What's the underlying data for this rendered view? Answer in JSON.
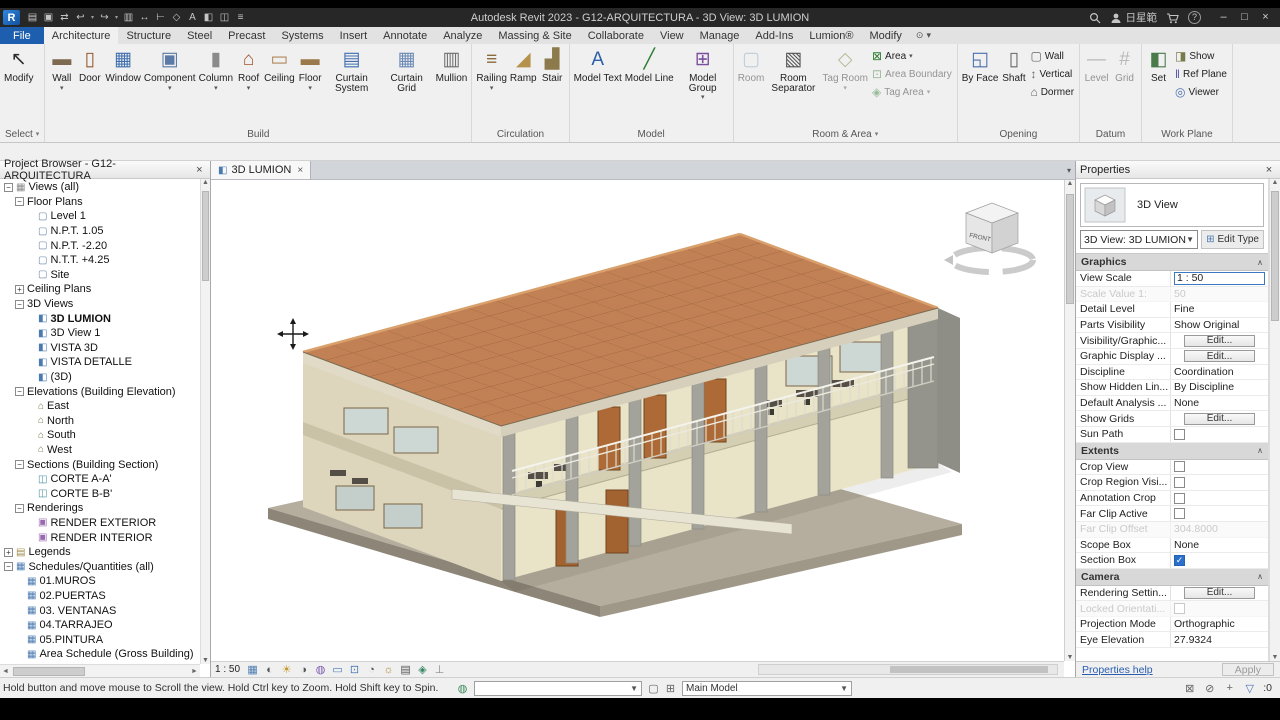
{
  "colors": {
    "accent_blue": "#1d5fae",
    "roof_terracotta": "#c28155",
    "selection_border": "#3a78c0",
    "checkbox_blue": "#2a6fc9"
  },
  "title_bar": {
    "title": "Autodesk Revit 2023 - G12-ARQUITECTURA - 3D View: 3D LUMION",
    "account": "日星範",
    "help_glyph": "?",
    "window_buttons": [
      "–",
      "□",
      "×"
    ],
    "quick_icons": [
      "open-file",
      "save",
      "sync-central",
      "undo",
      "redo",
      "print",
      "measure",
      "aligned-dimension",
      "tag-by-category",
      "text",
      "default-3d",
      "section",
      "thin-lines"
    ]
  },
  "tabs": {
    "file": "File",
    "active": "Architecture",
    "items": [
      "Architecture",
      "Structure",
      "Steel",
      "Precast",
      "Systems",
      "Insert",
      "Annotate",
      "Analyze",
      "Massing & Site",
      "Collaborate",
      "View",
      "Manage",
      "Add-Ins",
      "Lumion®",
      "Modify"
    ]
  },
  "ribbon": {
    "panels": [
      {
        "label": "Select",
        "arrow": true,
        "buttons": [
          {
            "t": "big",
            "label": "Modify",
            "icon": "modify-cursor"
          }
        ]
      },
      {
        "label": "Build",
        "buttons": [
          {
            "t": "big",
            "label": "Wall",
            "icon": "wall",
            "arrow": true
          },
          {
            "t": "big",
            "label": "Door",
            "icon": "door"
          },
          {
            "t": "big",
            "label": "Window",
            "icon": "window"
          },
          {
            "t": "big",
            "label": "Component",
            "icon": "component",
            "arrow": true
          },
          {
            "t": "big",
            "label": "Column",
            "icon": "column",
            "arrow": true
          },
          {
            "t": "big",
            "label": "Roof",
            "icon": "roof",
            "arrow": true
          },
          {
            "t": "big",
            "label": "Ceiling",
            "icon": "ceiling"
          },
          {
            "t": "big",
            "label": "Floor",
            "icon": "floor",
            "arrow": true
          },
          {
            "t": "big",
            "label": "Curtain System",
            "icon": "curtain-system"
          },
          {
            "t": "big",
            "label": "Curtain Grid",
            "icon": "curtain-grid"
          },
          {
            "t": "big",
            "label": "Mullion",
            "icon": "mullion"
          }
        ]
      },
      {
        "label": "Circulation",
        "buttons": [
          {
            "t": "big",
            "label": "Railing",
            "icon": "railing",
            "arrow": true
          },
          {
            "t": "big",
            "label": "Ramp",
            "icon": "ramp"
          },
          {
            "t": "big",
            "label": "Stair",
            "icon": "stair"
          }
        ]
      },
      {
        "label": "Model",
        "buttons": [
          {
            "t": "big",
            "label": "Model Text",
            "icon": "model-text"
          },
          {
            "t": "big",
            "label": "Model Line",
            "icon": "model-line"
          },
          {
            "t": "big",
            "label": "Model Group",
            "icon": "model-group",
            "arrow": true
          }
        ]
      },
      {
        "label": "Room & Area",
        "arrow": true,
        "buttons": [
          {
            "t": "big",
            "label": "Room",
            "icon": "room",
            "disabled": true
          },
          {
            "t": "big",
            "label": "Room Separator",
            "icon": "room-separator"
          },
          {
            "t": "big",
            "label": "Tag Room",
            "icon": "tag-room",
            "arrow": true,
            "disabled": true
          },
          {
            "t": "stack",
            "items": [
              {
                "label": "Area",
                "icon": "area",
                "arrow": true
              },
              {
                "label": "Area Boundary",
                "icon": "area-boundary",
                "disabled": true
              },
              {
                "label": "Tag Area",
                "icon": "tag-area",
                "arrow": true,
                "disabled": true
              }
            ]
          }
        ]
      },
      {
        "label": "Opening",
        "buttons": [
          {
            "t": "big",
            "label": "By Face",
            "icon": "by-face"
          },
          {
            "t": "big",
            "label": "Shaft",
            "icon": "shaft"
          },
          {
            "t": "stack",
            "items": [
              {
                "label": "Wall",
                "icon": "opening-wall"
              },
              {
                "label": "Vertical",
                "icon": "vertical"
              },
              {
                "label": "Dormer",
                "icon": "dormer"
              }
            ]
          }
        ]
      },
      {
        "label": "Datum",
        "buttons": [
          {
            "t": "big",
            "label": "Level",
            "icon": "level",
            "disabled": true
          },
          {
            "t": "big",
            "label": "Grid",
            "icon": "grid",
            "disabled": true
          }
        ]
      },
      {
        "label": "Work Plane",
        "buttons": [
          {
            "t": "big",
            "label": "Set",
            "icon": "set"
          },
          {
            "t": "stack",
            "items": [
              {
                "label": "Show",
                "icon": "show"
              },
              {
                "label": "Ref Plane",
                "icon": "ref-plane"
              },
              {
                "label": "Viewer",
                "icon": "viewer"
              }
            ]
          }
        ]
      }
    ]
  },
  "project_browser": {
    "header": "Project Browser - G12-ARQUITECTURA",
    "close": "×",
    "items": [
      {
        "l": "Views (all)",
        "v": 0,
        "e": "-",
        "i": "tree-root"
      },
      {
        "l": "Floor Plans",
        "v": 1,
        "e": "-"
      },
      {
        "l": "Level 1",
        "v": 2,
        "i": "tree-plan"
      },
      {
        "l": "N.P.T. 1.05",
        "v": 2,
        "i": "tree-plan"
      },
      {
        "l": "N.P.T. -2.20",
        "v": 2,
        "i": "tree-plan"
      },
      {
        "l": "N.T.T. +4.25",
        "v": 2,
        "i": "tree-plan"
      },
      {
        "l": "Site",
        "v": 2,
        "i": "tree-plan"
      },
      {
        "l": "Ceiling Plans",
        "v": 1,
        "e": "+"
      },
      {
        "l": "3D Views",
        "v": 1,
        "e": "-"
      },
      {
        "l": "3D LUMION",
        "v": 2,
        "i": "tree-3d",
        "b": 1
      },
      {
        "l": "3D View 1",
        "v": 2,
        "i": "tree-3d"
      },
      {
        "l": "VISTA 3D",
        "v": 2,
        "i": "tree-3d"
      },
      {
        "l": "VISTA DETALLE",
        "v": 2,
        "i": "tree-3d"
      },
      {
        "l": "(3D)",
        "v": 2,
        "i": "tree-3d"
      },
      {
        "l": "Elevations (Building Elevation)",
        "v": 1,
        "e": "-"
      },
      {
        "l": "East",
        "v": 2,
        "i": "tree-elev"
      },
      {
        "l": "North",
        "v": 2,
        "i": "tree-elev"
      },
      {
        "l": "South",
        "v": 2,
        "i": "tree-elev"
      },
      {
        "l": "West",
        "v": 2,
        "i": "tree-elev"
      },
      {
        "l": "Sections (Building Section)",
        "v": 1,
        "e": "-"
      },
      {
        "l": "CORTE A-A'",
        "v": 2,
        "i": "tree-section"
      },
      {
        "l": "CORTE B-B'",
        "v": 2,
        "i": "tree-section"
      },
      {
        "l": "Renderings",
        "v": 1,
        "e": "-"
      },
      {
        "l": "RENDER EXTERIOR",
        "v": 2,
        "i": "tree-render"
      },
      {
        "l": "RENDER INTERIOR",
        "v": 2,
        "i": "tree-render"
      },
      {
        "l": "Legends",
        "v": 0,
        "e": "+",
        "i": "tree-legend"
      },
      {
        "l": "Schedules/Quantities (all)",
        "v": 0,
        "e": "-",
        "i": "tree-sched"
      },
      {
        "l": "01.MUROS",
        "v": 1,
        "i": "tree-sched"
      },
      {
        "l": "02.PUERTAS",
        "v": 1,
        "i": "tree-sched"
      },
      {
        "l": "03. VENTANAS",
        "v": 1,
        "i": "tree-sched"
      },
      {
        "l": "04.TARRAJEO",
        "v": 1,
        "i": "tree-sched"
      },
      {
        "l": "05.PINTURA",
        "v": 1,
        "i": "tree-sched"
      },
      {
        "l": "Area Schedule (Gross Building)",
        "v": 1,
        "i": "tree-sched"
      }
    ]
  },
  "viewport": {
    "tab_label": "3D LUMION",
    "tab_close": "×",
    "scale_label": "1 : 50",
    "viewcube_front": "FRONT",
    "control_icons": [
      "detail-level",
      "visual-style",
      "sun-path",
      "shadows",
      "render-dialog",
      "crop-view",
      "show-crop",
      "hide-isolate",
      "reveal-hidden",
      "temp-view",
      "analytical",
      "constraints"
    ]
  },
  "properties": {
    "header": "Properties",
    "close": "×",
    "type_name": "3D View",
    "type_selector": "3D View: 3D LUMION",
    "edit_type_label": "Edit Type",
    "help_link": "Properties help",
    "apply_label": "Apply",
    "sections": [
      {
        "header": "Graphics",
        "rows": [
          {
            "label": "View Scale",
            "value": "1 : 50",
            "type": "input"
          },
          {
            "label": "Scale Value    1:",
            "value": "50",
            "type": "text",
            "disabled": true
          },
          {
            "label": "Detail Level",
            "value": "Fine",
            "type": "text"
          },
          {
            "label": "Parts Visibility",
            "value": "Show Original",
            "type": "text"
          },
          {
            "label": "Visibility/Graphic...",
            "value": "Edit...",
            "type": "button"
          },
          {
            "label": "Graphic Display ...",
            "value": "Edit...",
            "type": "button"
          },
          {
            "label": "Discipline",
            "value": "Coordination",
            "type": "text"
          },
          {
            "label": "Show Hidden Lin...",
            "value": "By Discipline",
            "type": "text"
          },
          {
            "label": "Default Analysis ...",
            "value": "None",
            "type": "text"
          },
          {
            "label": "Show Grids",
            "value": "Edit...",
            "type": "button"
          },
          {
            "label": "Sun Path",
            "type": "check",
            "checked": false
          }
        ]
      },
      {
        "header": "Extents",
        "rows": [
          {
            "label": "Crop View",
            "type": "check",
            "checked": false
          },
          {
            "label": "Crop Region Visi...",
            "type": "check",
            "checked": false
          },
          {
            "label": "Annotation Crop",
            "type": "check",
            "checked": false
          },
          {
            "label": "Far Clip Active",
            "type": "check",
            "checked": false
          },
          {
            "label": "Far Clip Offset",
            "value": "304.8000",
            "type": "text",
            "disabled": true
          },
          {
            "label": "Scope Box",
            "value": "None",
            "type": "text"
          },
          {
            "label": "Section Box",
            "type": "check",
            "checked": true
          }
        ]
      },
      {
        "header": "Camera",
        "rows": [
          {
            "label": "Rendering Settin...",
            "value": "Edit...",
            "type": "button"
          },
          {
            "label": "Locked Orientati...",
            "type": "check",
            "checked": false,
            "disabled": true
          },
          {
            "label": "Projection Mode",
            "value": "Orthographic",
            "type": "text"
          },
          {
            "label": "Eye Elevation",
            "value": "27.9324",
            "type": "text"
          }
        ]
      }
    ]
  },
  "status_bar": {
    "hint": "Hold button and move mouse to Scroll the view. Hold Ctrl key to Zoom. Hold Shift key to Spin.",
    "worksets_icon": "worksets",
    "mid_icons": [
      "editable-only",
      "design-options"
    ],
    "main_model": "Main Model",
    "right_icons": [
      "editable-items",
      "exclude-options",
      "press-drag",
      "filter"
    ],
    "filter_count": ":0"
  }
}
